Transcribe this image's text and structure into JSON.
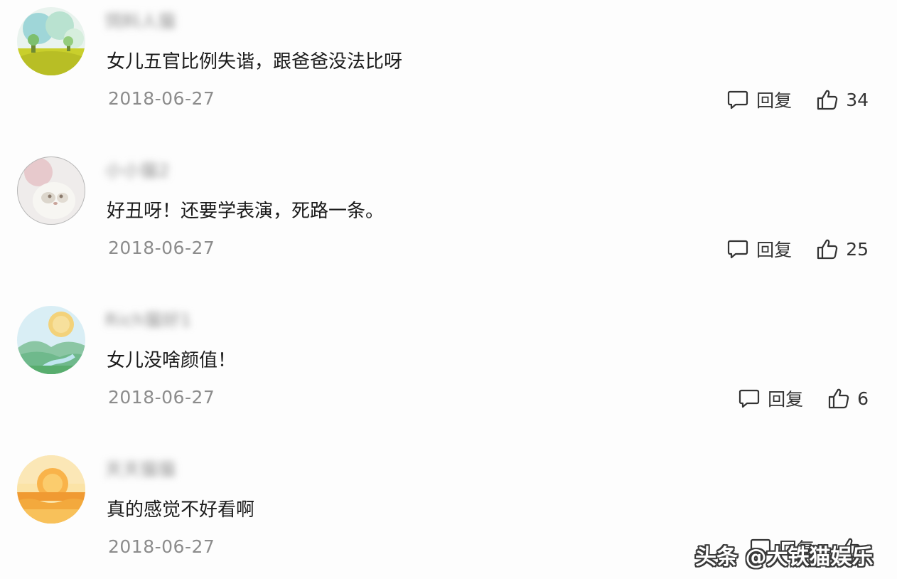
{
  "reply_label": "回复",
  "watermark": "头条 @大铁猫娱乐",
  "comments": [
    {
      "username": "饲料人猫",
      "avatar": "avatar-meadow-tree",
      "text": "女儿五官比例失谐，跟爸爸没法比呀",
      "date": "2018-06-27",
      "likes": "34"
    },
    {
      "username": "小小猫2",
      "avatar": "avatar-white-cat",
      "text": "好丑呀！还要学表演，死路一条。",
      "date": "2018-06-27",
      "likes": "25"
    },
    {
      "username": "Rich猫好1",
      "avatar": "avatar-sunny-hills",
      "text": "女儿没啥颜值！",
      "date": "2018-06-27",
      "likes": "6"
    },
    {
      "username": "天天猫猫",
      "avatar": "avatar-sunset",
      "text": "真的感觉不好看啊",
      "date": "2018-06-27",
      "likes": ""
    }
  ]
}
